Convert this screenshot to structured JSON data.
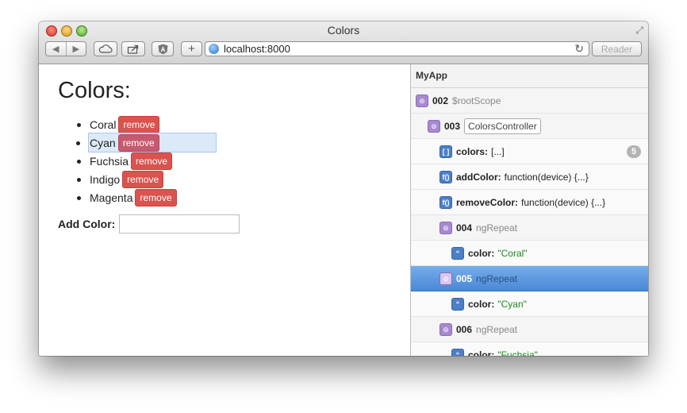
{
  "window": {
    "title": "Colors",
    "url": "localhost:8000",
    "reader_label": "Reader",
    "add_label": "+"
  },
  "page": {
    "title": "Colors:",
    "remove_label": "remove",
    "colors": [
      "Coral",
      "Cyan",
      "Fuchsia",
      "Indigo",
      "Magenta"
    ],
    "add_color_label": "Add Color:",
    "add_color_value": ""
  },
  "inspector": {
    "app_name": "MyApp",
    "rows": [
      {
        "kind": "scope",
        "id": "002",
        "name": "$rootScope"
      },
      {
        "kind": "scope",
        "id": "003",
        "controller": "ColorsController"
      },
      {
        "kind": "prop",
        "icon": "[ ]",
        "key": "colors:",
        "value": "[...]",
        "count": "5"
      },
      {
        "kind": "prop",
        "icon": "f()",
        "key": "addColor:",
        "value": "function(device) {...}"
      },
      {
        "kind": "prop",
        "icon": "f()",
        "key": "removeColor:",
        "value": "function(device) {...}"
      },
      {
        "kind": "scope",
        "id": "004",
        "name": "ngRepeat"
      },
      {
        "kind": "prop",
        "icon": "“",
        "key": "color:",
        "string": "\"Coral\""
      },
      {
        "kind": "scope",
        "id": "005",
        "name": "ngRepeat",
        "selected": true
      },
      {
        "kind": "prop",
        "icon": "“",
        "key": "color:",
        "string": "\"Cyan\""
      },
      {
        "kind": "scope",
        "id": "006",
        "name": "ngRepeat"
      },
      {
        "kind": "prop",
        "icon": "“",
        "key": "color:",
        "string": "\"Fuchsia\""
      }
    ]
  },
  "colors": {
    "remove_button": "#d9534f",
    "selected_row": "#4a88d6",
    "string_value": "#1a8a1a"
  }
}
